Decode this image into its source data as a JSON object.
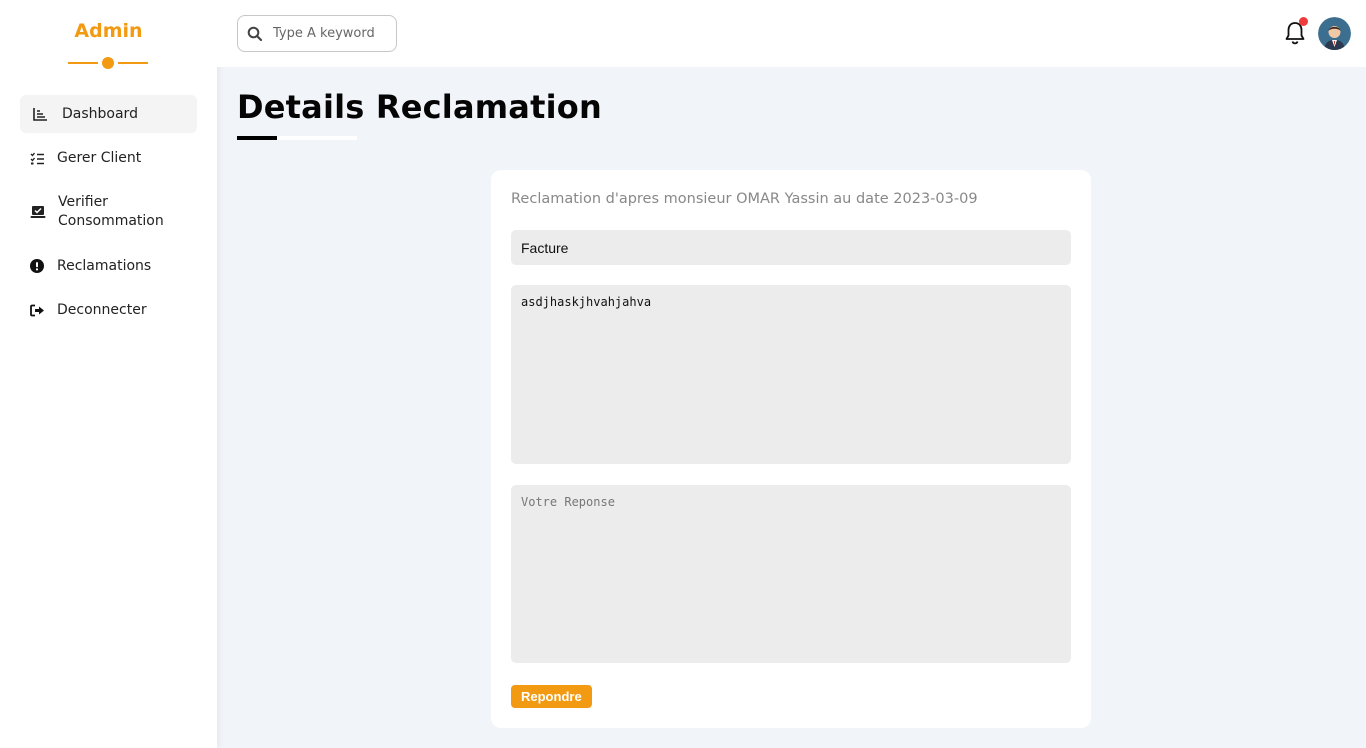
{
  "brand": {
    "title": "Admin"
  },
  "colors": {
    "accent": "#f29a11",
    "badge": "#ee3b3b",
    "background": "#f1f4f9"
  },
  "sidebar": {
    "items": [
      {
        "label": "Dashboard",
        "icon": "chart-icon",
        "active": true
      },
      {
        "label": "Gerer Client",
        "icon": "list-check-icon"
      },
      {
        "label": "Verifier Consommation",
        "icon": "laptop-check-icon"
      },
      {
        "label": "Reclamations",
        "icon": "exclamation-circle-icon"
      },
      {
        "label": "Deconnecter",
        "icon": "logout-icon"
      }
    ]
  },
  "header": {
    "search": {
      "placeholder": "Type A keyword"
    },
    "notifications": {
      "icon": "bell-icon",
      "has_unread": true
    },
    "user": {
      "icon": "avatar"
    }
  },
  "main": {
    "title": "Details Reclamation",
    "card": {
      "heading": "Reclamation d'apres monsieur OMAR Yassin au date 2023-03-09",
      "subject": "Facture",
      "message": "asdjhaskjhvahjahva",
      "reply_placeholder": "Votre Reponse",
      "submit_label": "Repondre"
    }
  }
}
